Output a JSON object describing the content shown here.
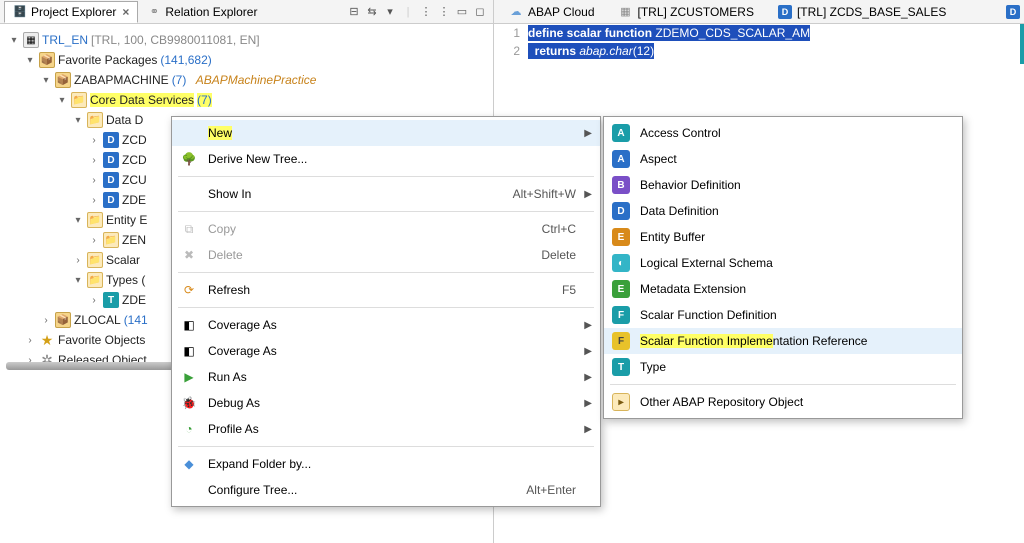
{
  "views": {
    "tabs": [
      {
        "label": "Project Explorer",
        "active": true
      },
      {
        "label": "Relation Explorer",
        "active": false
      }
    ]
  },
  "tree": {
    "project_name": "TRL_EN",
    "project_meta": "[TRL, 100, CB9980011081, EN]",
    "fav_label": "Favorite Packages",
    "fav_count": "(141,682)",
    "pkg_name": "ZABAPMACHINE",
    "pkg_count": "(7)",
    "pkg_desc": "ABAPMachinePractice",
    "cds_label": "Core Data Services",
    "cds_count": "(7)",
    "dd_label": "Data D",
    "dd_items": [
      "ZCD",
      "ZCD",
      "ZCU",
      "ZDE"
    ],
    "entity_label": "Entity E",
    "entity_item": "ZEN",
    "scalar_label": "Scalar",
    "types_label": "Types (",
    "types_item": "ZDE",
    "zlocal_label": "ZLOCAL",
    "zlocal_count": "(141",
    "favobj_label": "Favorite Objects",
    "released_label": "Released Object"
  },
  "context_menu": {
    "items": [
      {
        "label": "New",
        "shortcut": "",
        "sub": true,
        "icon": "",
        "highlight": true
      },
      {
        "label": "Derive New Tree...",
        "icon": "tree"
      },
      {
        "sep": true
      },
      {
        "label": "Show In",
        "shortcut": "Alt+Shift+W",
        "sub": true
      },
      {
        "sep": true
      },
      {
        "label": "Copy",
        "shortcut": "Ctrl+C",
        "icon": "copy",
        "disabled": true
      },
      {
        "label": "Delete",
        "shortcut": "Delete",
        "icon": "x",
        "disabled": true
      },
      {
        "sep": true
      },
      {
        "label": "Refresh",
        "shortcut": "F5",
        "icon": "refresh"
      },
      {
        "sep": true
      },
      {
        "label": "Coverage As",
        "sub": true,
        "icon": "cov"
      },
      {
        "label": "Coverage As",
        "sub": true,
        "icon": "cov"
      },
      {
        "label": "Run As",
        "sub": true,
        "icon": "run"
      },
      {
        "label": "Debug As",
        "sub": true,
        "icon": "debug"
      },
      {
        "label": "Profile As",
        "sub": true,
        "icon": "profile"
      },
      {
        "sep": true
      },
      {
        "label": "Expand Folder by...",
        "icon": "expand"
      },
      {
        "label": "Configure Tree...",
        "shortcut": "Alt+Enter"
      }
    ]
  },
  "sub_menu": {
    "items": [
      {
        "label": "Access Control",
        "color": "c-teal",
        "glyph": "A"
      },
      {
        "label": "Aspect",
        "color": "c-blue",
        "glyph": "A"
      },
      {
        "label": "Behavior Definition",
        "color": "c-purple",
        "glyph": "B"
      },
      {
        "label": "Data Definition",
        "color": "c-blue",
        "glyph": "D"
      },
      {
        "label": "Entity Buffer",
        "color": "c-orange",
        "glyph": "E"
      },
      {
        "label": "Logical External Schema",
        "color": "c-cyan",
        "glyph": "◐"
      },
      {
        "label": "Metadata Extension",
        "color": "c-green",
        "glyph": "E"
      },
      {
        "label": "Scalar Function Definition",
        "color": "c-teal",
        "glyph": "F"
      },
      {
        "label": "Scalar Function Implementation Reference",
        "color": "c-yellow",
        "glyph": "F",
        "highlight": true
      },
      {
        "label": "Type",
        "color": "c-teal",
        "glyph": "T"
      }
    ],
    "other": "Other ABAP Repository Object"
  },
  "editor": {
    "tabs": [
      {
        "label": "ABAP Cloud",
        "icon": "cloud"
      },
      {
        "label": "[TRL] ZCUSTOMERS",
        "icon": "grid"
      },
      {
        "label": "[TRL] ZCDS_BASE_SALES",
        "icon": "D",
        "active": true
      }
    ],
    "line1_kw": "define scalar function",
    "line1_name": " ZDEMO_CDS_SCALAR_AM",
    "line2_kw": "returns",
    "line2_txt": " abap.char",
    "line2_paren": "(12)"
  }
}
